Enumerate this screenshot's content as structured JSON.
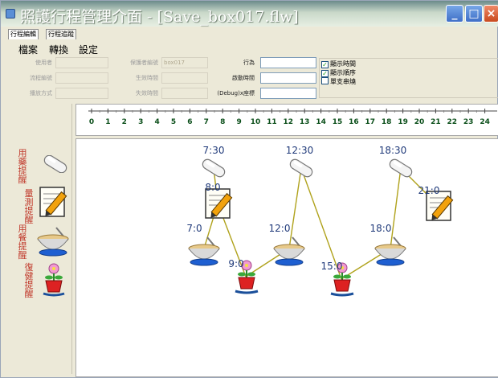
{
  "window": {
    "title": "照護行程管理介面 - [Save_box017.flw]",
    "buttons": {
      "minimize": "_",
      "maximize": "□",
      "close": "×"
    }
  },
  "tabs": [
    "行程編輯",
    "行程追蹤"
  ],
  "menu": [
    "檔案",
    "轉換",
    "設定"
  ],
  "form": {
    "left_labels": [
      "使用者",
      "流程編號",
      "播放方式"
    ],
    "mid_labels": [
      "保護者編號",
      "生效時間",
      "失效時間"
    ],
    "mid_values": [
      "box017",
      "",
      ""
    ],
    "right_labels": [
      "行為",
      "啟動時間",
      "(Debug)x座標"
    ],
    "checkboxes": [
      {
        "label": "顯示時間",
        "checked": true
      },
      {
        "label": "顯示順序",
        "checked": true
      },
      {
        "label": "單支串燒",
        "checked": false
      }
    ]
  },
  "palette": {
    "items": [
      {
        "label": "用藥提醒",
        "icon": "pill-icon"
      },
      {
        "label": "量測提醒",
        "icon": "measure-pen-icon"
      },
      {
        "label": "用餐提醒",
        "icon": "meal-bowl-icon"
      },
      {
        "label": "復健提醒",
        "icon": "rehab-plant-icon"
      }
    ]
  },
  "ruler": {
    "ticks": [
      "0",
      "1",
      "2",
      "3",
      "4",
      "5",
      "6",
      "7",
      "8",
      "9",
      "10",
      "11",
      "12",
      "13",
      "14",
      "15",
      "16",
      "17",
      "18",
      "19",
      "20",
      "21",
      "22",
      "23",
      "24"
    ]
  },
  "flow": {
    "nodes": [
      {
        "id": "n1",
        "time": "7:30",
        "type": "pill-icon"
      },
      {
        "id": "n2",
        "time": "8:0",
        "type": "measure-pen-icon"
      },
      {
        "id": "n3",
        "time": "7:0",
        "type": "meal-bowl-icon"
      },
      {
        "id": "n4",
        "time": "9:0",
        "type": "rehab-plant-icon"
      },
      {
        "id": "n5",
        "time": "12:0",
        "type": "meal-bowl-icon"
      },
      {
        "id": "n6",
        "time": "12:30",
        "type": "pill-icon"
      },
      {
        "id": "n7",
        "time": "15:0",
        "type": "rehab-plant-icon"
      },
      {
        "id": "n8",
        "time": "18:0",
        "type": "meal-bowl-icon"
      },
      {
        "id": "n9",
        "time": "18:30",
        "type": "pill-icon"
      },
      {
        "id": "n10",
        "time": "21:0",
        "type": "measure-pen-icon"
      }
    ],
    "link_color": "#b0a21c"
  }
}
